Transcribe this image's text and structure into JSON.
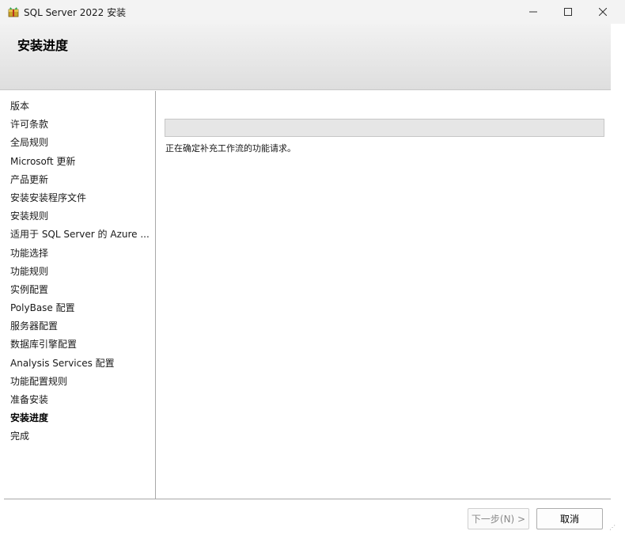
{
  "window": {
    "title": "SQL Server 2022 安装",
    "minimize_symbol": "—",
    "maximize_symbol": "☐",
    "close_symbol": "✕"
  },
  "header": {
    "title": "安装进度"
  },
  "sidebar": {
    "items": [
      {
        "label": "版本"
      },
      {
        "label": "许可条款"
      },
      {
        "label": "全局规则"
      },
      {
        "label": "Microsoft 更新"
      },
      {
        "label": "产品更新"
      },
      {
        "label": "安装安装程序文件"
      },
      {
        "label": "安装规则"
      },
      {
        "label": "适用于 SQL Server 的 Azure ..."
      },
      {
        "label": "功能选择"
      },
      {
        "label": "功能规则"
      },
      {
        "label": "实例配置"
      },
      {
        "label": "PolyBase 配置"
      },
      {
        "label": "服务器配置"
      },
      {
        "label": "数据库引擎配置"
      },
      {
        "label": "Analysis Services 配置"
      },
      {
        "label": "功能配置规则"
      },
      {
        "label": "准备安装"
      },
      {
        "label": "安装进度"
      },
      {
        "label": "完成"
      }
    ],
    "active_index": 17
  },
  "main": {
    "progress_fraction": 0,
    "status_text": "正在确定补充工作流的功能请求。"
  },
  "footer": {
    "next_label": "下一步(N) >",
    "cancel_label": "取消"
  },
  "colors": {
    "header_gradient_top": "#f2f2f2",
    "header_gradient_bottom": "#dedede",
    "progress_track": "#e6e6e6",
    "progress_fill": "#06b025"
  }
}
